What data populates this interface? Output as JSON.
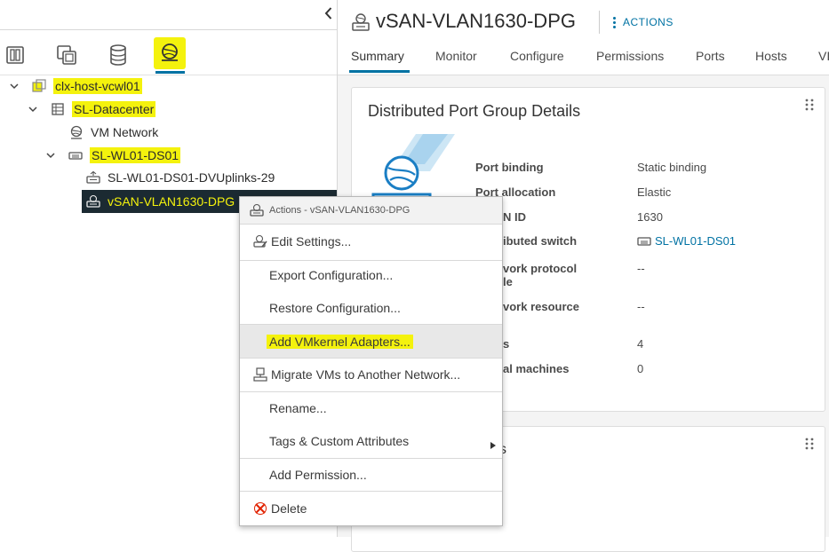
{
  "navigator": {
    "collapse_icon": "chevron-left-icon",
    "views": [
      {
        "icon": "hosts-clusters-icon"
      },
      {
        "icon": "vms-templates-icon"
      },
      {
        "icon": "storage-icon"
      },
      {
        "icon": "networking-icon",
        "active": true
      }
    ]
  },
  "tree": [
    {
      "label": "clx-host-vcwl01",
      "icon": "vcenter-icon",
      "expanded": true
    },
    {
      "label": "SL-Datacenter",
      "icon": "datacenter-icon",
      "expanded": true
    },
    {
      "label": "VM Network",
      "icon": "network-icon"
    },
    {
      "label": "SL-WL01-DS01",
      "icon": "distributed-switch-icon",
      "expanded": true
    },
    {
      "label": "SL-WL01-DS01-DVUplinks-29",
      "icon": "uplink-portgroup-icon"
    },
    {
      "label": "vSAN-VLAN1630-DPG",
      "icon": "portgroup-icon",
      "selected": true
    }
  ],
  "header": {
    "title": "vSAN-VLAN1630-DPG",
    "actions_label": "ACTIONS"
  },
  "tabs": [
    "Summary",
    "Monitor",
    "Configure",
    "Permissions",
    "Ports",
    "Hosts",
    "VI"
  ],
  "details_card": {
    "title": "Distributed Port Group Details",
    "properties": [
      {
        "label": "Port binding",
        "value": "Static binding"
      },
      {
        "label": "Port allocation",
        "value": "Elastic"
      },
      {
        "label": "N ID",
        "value": "1630"
      },
      {
        "label": "ibuted switch",
        "value": "SL-WL01-DS01"
      },
      {
        "label": "vork protocol",
        "label2": "le",
        "value": "--"
      },
      {
        "label": "vork resource",
        "value": "--"
      },
      {
        "label": "s",
        "value": "4"
      },
      {
        "label": "al machines",
        "value": "0"
      }
    ]
  },
  "second_card": {
    "title_fragment": "s"
  },
  "context_menu": {
    "header": "Actions - vSAN-VLAN1630-DPG",
    "items": {
      "edit_settings": "Edit Settings...",
      "export_configuration": "Export Configuration...",
      "restore_configuration": "Restore Configuration...",
      "add_vmkernel_adapters": "Add VMkernel Adapters...",
      "migrate_vms": "Migrate VMs to Another Network...",
      "rename": "Rename...",
      "tags_custom_attributes": "Tags & Custom Attributes",
      "add_permission": "Add Permission...",
      "delete": "Delete"
    }
  },
  "colors": {
    "accent": "#0072a3",
    "highlight": "#f4f20d",
    "selected_row": "#1b2a32",
    "delete_icon": "#e12200",
    "link": "#0072a3"
  }
}
